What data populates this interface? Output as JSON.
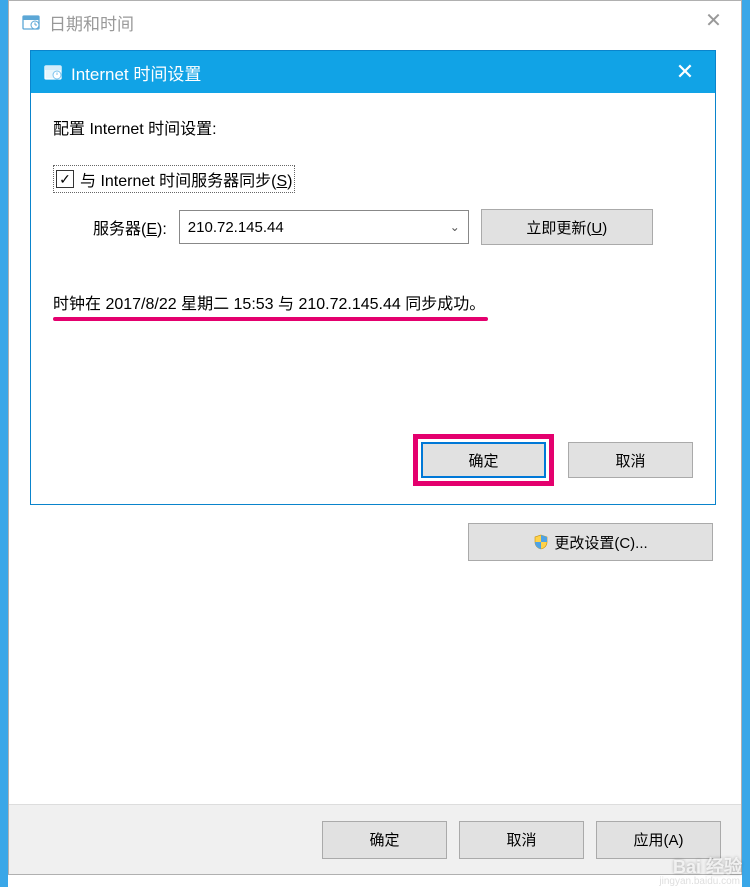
{
  "parentWindow": {
    "title": "日期和时间",
    "closeGlyph": "✕",
    "changeSettingsLabel": "更改设置(C)...",
    "footer": {
      "okLabel": "确定",
      "cancelLabel": "取消",
      "applyLabel": "应用(A)"
    }
  },
  "modal": {
    "title": "Internet 时间设置",
    "closeGlyph": "✕",
    "heading": "配置 Internet 时间设置:",
    "checkbox": {
      "checked": true,
      "checkGlyph": "✓",
      "labelPre": "与 Internet 时间服务器同步(",
      "mnemonic": "S",
      "labelPost": ")"
    },
    "server": {
      "labelPre": "服务器(",
      "mnemonic": "E",
      "labelPost": "):",
      "value": "210.72.145.44",
      "arrowGlyph": "⌄",
      "updateLabelPre": "立即更新(",
      "updateMnemonic": "U",
      "updateLabelPost": ")"
    },
    "status": "时钟在 2017/8/22 星期二 15:53 与 210.72.145.44 同步成功。",
    "footer": {
      "okLabel": "确定",
      "cancelLabel": "取消"
    }
  },
  "watermark": {
    "text": "Bai           经验",
    "sub": "jingyan.baidu.com"
  },
  "colors": {
    "accent": "#11a3e6",
    "highlight": "#e4006e",
    "buttonBorder": "#0078d7"
  }
}
